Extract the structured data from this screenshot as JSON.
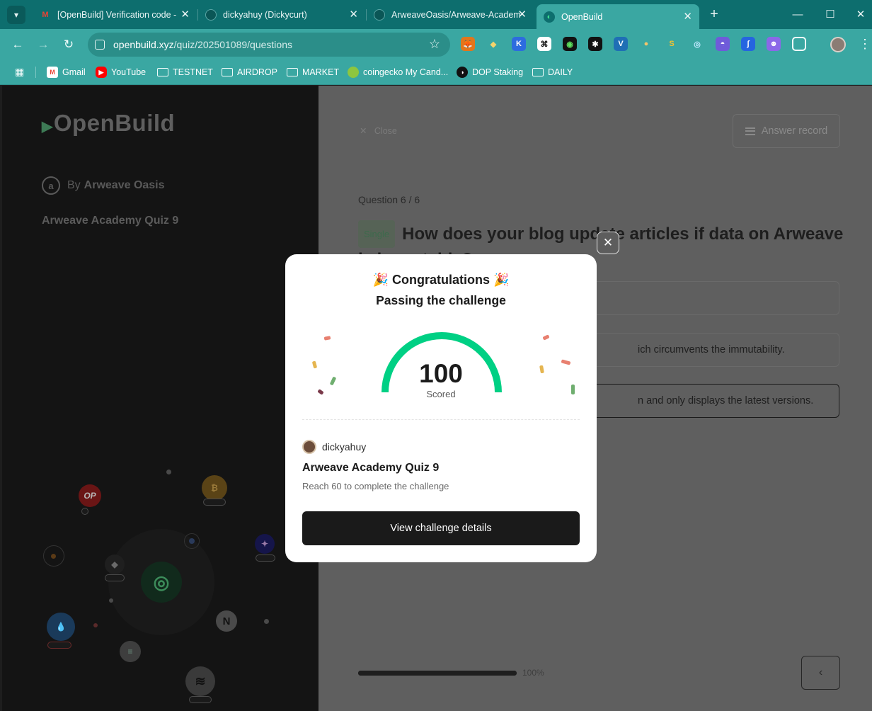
{
  "browser": {
    "tabs": [
      {
        "title": "[OpenBuild] Verification code - ",
        "favicon": "gmail-icon"
      },
      {
        "title": "dickyahuy (Dickycurt)",
        "favicon": "github-icon"
      },
      {
        "title": "ArweaveOasis/Arweave-Academ",
        "favicon": "github-icon"
      },
      {
        "title": "OpenBuild",
        "favicon": "openbuild-icon",
        "active": true
      }
    ],
    "url_host": "openbuild.xyz",
    "url_path": "/quiz/202501089/questions",
    "bookmarks": [
      {
        "label": "Gmail",
        "icon": "gmail-icon"
      },
      {
        "label": "YouTube",
        "icon": "youtube-icon"
      },
      {
        "label": "TESTNET",
        "icon": "folder-icon"
      },
      {
        "label": "AIRDROP",
        "icon": "folder-icon"
      },
      {
        "label": "MARKET",
        "icon": "folder-icon"
      },
      {
        "label": "coingecko My Cand...",
        "icon": "coingecko-icon"
      },
      {
        "label": "DOP Staking",
        "icon": "dop-icon"
      },
      {
        "label": "DAILY",
        "icon": "folder-icon"
      }
    ]
  },
  "left": {
    "logo": "OpenBuild",
    "by": "By",
    "org": "Arweave Oasis",
    "quiz_title": "Arweave Academy Quiz 9",
    "network_labels": {
      "op": "OP",
      "near": "N"
    }
  },
  "right": {
    "close": "Close",
    "answer_record": "Answer record",
    "question_progress": "Question 6 / 6",
    "question_type": "Single",
    "question": "How does your blog update articles if data on Arweave is immutable?",
    "options": [
      {
        "text": "",
        "selected": false
      },
      {
        "text": "ich circumvents the immutability.",
        "selected": false
      },
      {
        "text": "n and only displays the latest versions.",
        "selected": true
      }
    ],
    "progress_percent": 100,
    "progress_label": "100%"
  },
  "modal": {
    "congrats": "🎉 Congratulations 🎉",
    "subtitle": "Passing the challenge",
    "score": "100",
    "score_max": 100,
    "score_label": "Scored",
    "username": "dickyahuy",
    "quiz_title": "Arweave Academy Quiz 9",
    "hint": "Reach 60 to complete the challenge",
    "button": "View challenge details",
    "gauge_color": "#00d084"
  }
}
